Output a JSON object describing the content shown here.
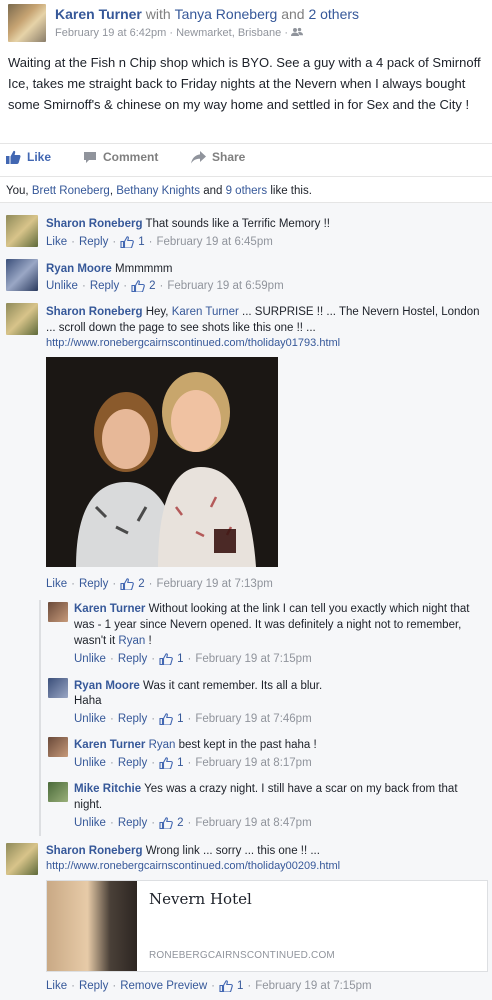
{
  "post": {
    "author": "Karen Turner",
    "with_text": "with",
    "tagged": "Tanya Roneberg",
    "and_text": "and",
    "others": "2 others",
    "date": "February 19 at 6:42pm",
    "location": "Newmarket, Brisbane",
    "separator": "·",
    "privacy_icon": "friends-icon",
    "text": "Waiting at the Fish n Chip shop which is BYO. See a guy with a 4 pack of Smirnoff Ice, takes me straight back to Friday nights at the Nevern when I always bought some Smirnoff's & chinese on my way home and settled in for Sex and the City !"
  },
  "actions": {
    "like": "Like",
    "comment": "Comment",
    "share": "Share"
  },
  "likers": {
    "you": "You,",
    "name1": "Brett Roneberg",
    "comma": ",",
    "name2": "Bethany Knights",
    "and": "and",
    "others": "9 others",
    "suffix": "like this."
  },
  "comments": [
    {
      "name": "Sharon Roneberg",
      "text": "That sounds like a Terrific Memory !!",
      "like": "Like",
      "reply": "Reply",
      "likes": "1",
      "time": "February 19 at 6:45pm"
    },
    {
      "name": "Ryan Moore",
      "text": "Mmmmmm",
      "like": "Unlike",
      "reply": "Reply",
      "likes": "2",
      "time": "February 19 at 6:59pm"
    },
    {
      "name": "Sharon Roneberg",
      "text_a": "Hey,",
      "mention": "Karen Turner",
      "text_b": "... SURPRISE !! ... The Nevern Hostel, London ... scroll down the page to see shots like this one !! ...",
      "url": "http://www.ronebergcairnscontinued.com/tholiday01793.html",
      "like": "Like",
      "reply": "Reply",
      "likes": "2",
      "time": "February 19 at 7:13pm"
    }
  ],
  "replies": [
    {
      "name": "Karen Turner",
      "text": "Without looking at the link I can tell you exactly which night that was - 1 year since Nevern opened. It was definitely a night not to remember, wasn't it",
      "mention": "Ryan",
      "tail": "!",
      "like": "Unlike",
      "reply": "Reply",
      "likes": "1",
      "time": "February 19 at 7:15pm"
    },
    {
      "name": "Ryan Moore",
      "text": "Was it cant remember. Its all a blur.",
      "text2": "Haha",
      "like": "Unlike",
      "reply": "Reply",
      "likes": "1",
      "time": "February 19 at 7:46pm"
    },
    {
      "name": "Karen Turner",
      "mention": "Ryan",
      "text": "best kept in the past haha !",
      "like": "Unlike",
      "reply": "Reply",
      "likes": "1",
      "time": "February 19 at 8:17pm"
    },
    {
      "name": "Mike Ritchie",
      "text": "Yes was a crazy night. I still have a scar on my back from that night.",
      "like": "Unlike",
      "reply": "Reply",
      "likes": "2",
      "time": "February 19 at 8:47pm"
    }
  ],
  "last_comment": {
    "name": "Sharon Roneberg",
    "text": "Wrong link ... sorry ... this one !! ...",
    "url": "http://www.ronebergcairnscontinued.com/tholiday00209.html",
    "card_title": "Nevern Hotel",
    "card_domain": "RONEBERGCAIRNSCONTINUED.COM",
    "like": "Like",
    "reply": "Reply",
    "remove_preview": "Remove Preview",
    "likes": "1",
    "time": "February 19 at 7:15pm"
  },
  "colors": {
    "link": "#365899",
    "like_blue": "#4267b2",
    "meta_gray": "#90949c",
    "panel_bg": "#f6f7f9"
  }
}
